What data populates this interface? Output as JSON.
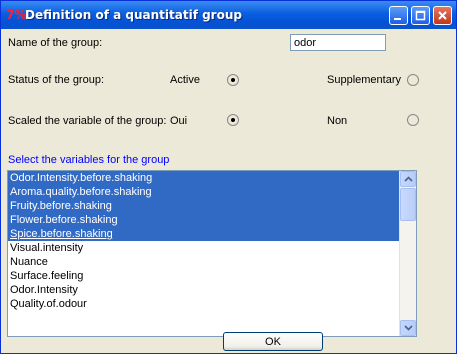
{
  "window": {
    "title": "Definition of a quantitatif group",
    "app_icon_glyph": "7%"
  },
  "name": {
    "label": "Name of the group:",
    "value": "odor"
  },
  "status": {
    "label": "Status of the group:",
    "active_label": "Active",
    "supplementary_label": "Supplementary",
    "selected": "Active"
  },
  "scaled": {
    "label": "Scaled the variable of the group:",
    "oui_label": "Oui",
    "non_label": "Non",
    "selected": "Oui"
  },
  "variables": {
    "label": "Select the variables for the group",
    "items": [
      {
        "text": "Odor.Intensity.before.shaking",
        "selected": true
      },
      {
        "text": "Aroma.quality.before.shaking",
        "selected": true
      },
      {
        "text": "Fruity.before.shaking",
        "selected": true
      },
      {
        "text": "Flower.before.shaking",
        "selected": true
      },
      {
        "text": "Spice.before.shaking",
        "selected": true
      },
      {
        "text": "Visual.intensity",
        "selected": false
      },
      {
        "text": "Nuance",
        "selected": false
      },
      {
        "text": "Surface.feeling",
        "selected": false
      },
      {
        "text": "Odor.Intensity",
        "selected": false
      },
      {
        "text": "Quality.of.odour",
        "selected": false
      }
    ]
  },
  "buttons": {
    "ok_label": "OK"
  },
  "colors": {
    "titlebar": "#0a5ee0",
    "selection": "#316ac5",
    "section_label": "#0000ff",
    "dialog_bg": "#ece9d8"
  }
}
